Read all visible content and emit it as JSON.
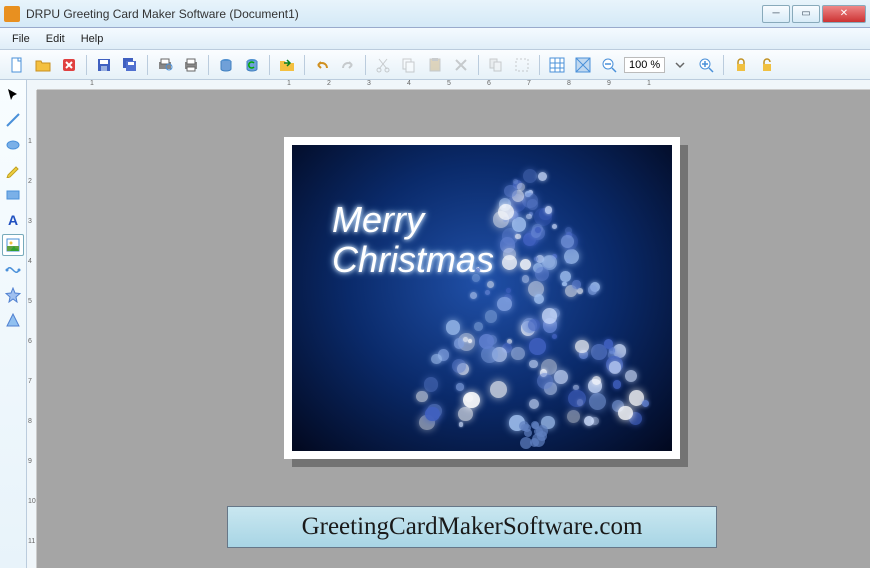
{
  "titlebar": {
    "title": "DRPU Greeting Card Maker Software  (Document1)"
  },
  "menu": {
    "file": "File",
    "edit": "Edit",
    "help": "Help"
  },
  "toolbar": {
    "zoom_value": "100 %"
  },
  "card": {
    "line1": "Merry",
    "line2": "Christmas"
  },
  "watermark": {
    "text": "GreetingCardMakerSoftware.com"
  },
  "hruler_ticks": [
    "1",
    "1",
    "2",
    "3",
    "4",
    "5",
    "6",
    "7",
    "8",
    "9",
    "1"
  ],
  "vruler_ticks": [
    "1",
    "2",
    "3",
    "4",
    "5",
    "6",
    "7",
    "8",
    "9",
    "10",
    "11"
  ]
}
